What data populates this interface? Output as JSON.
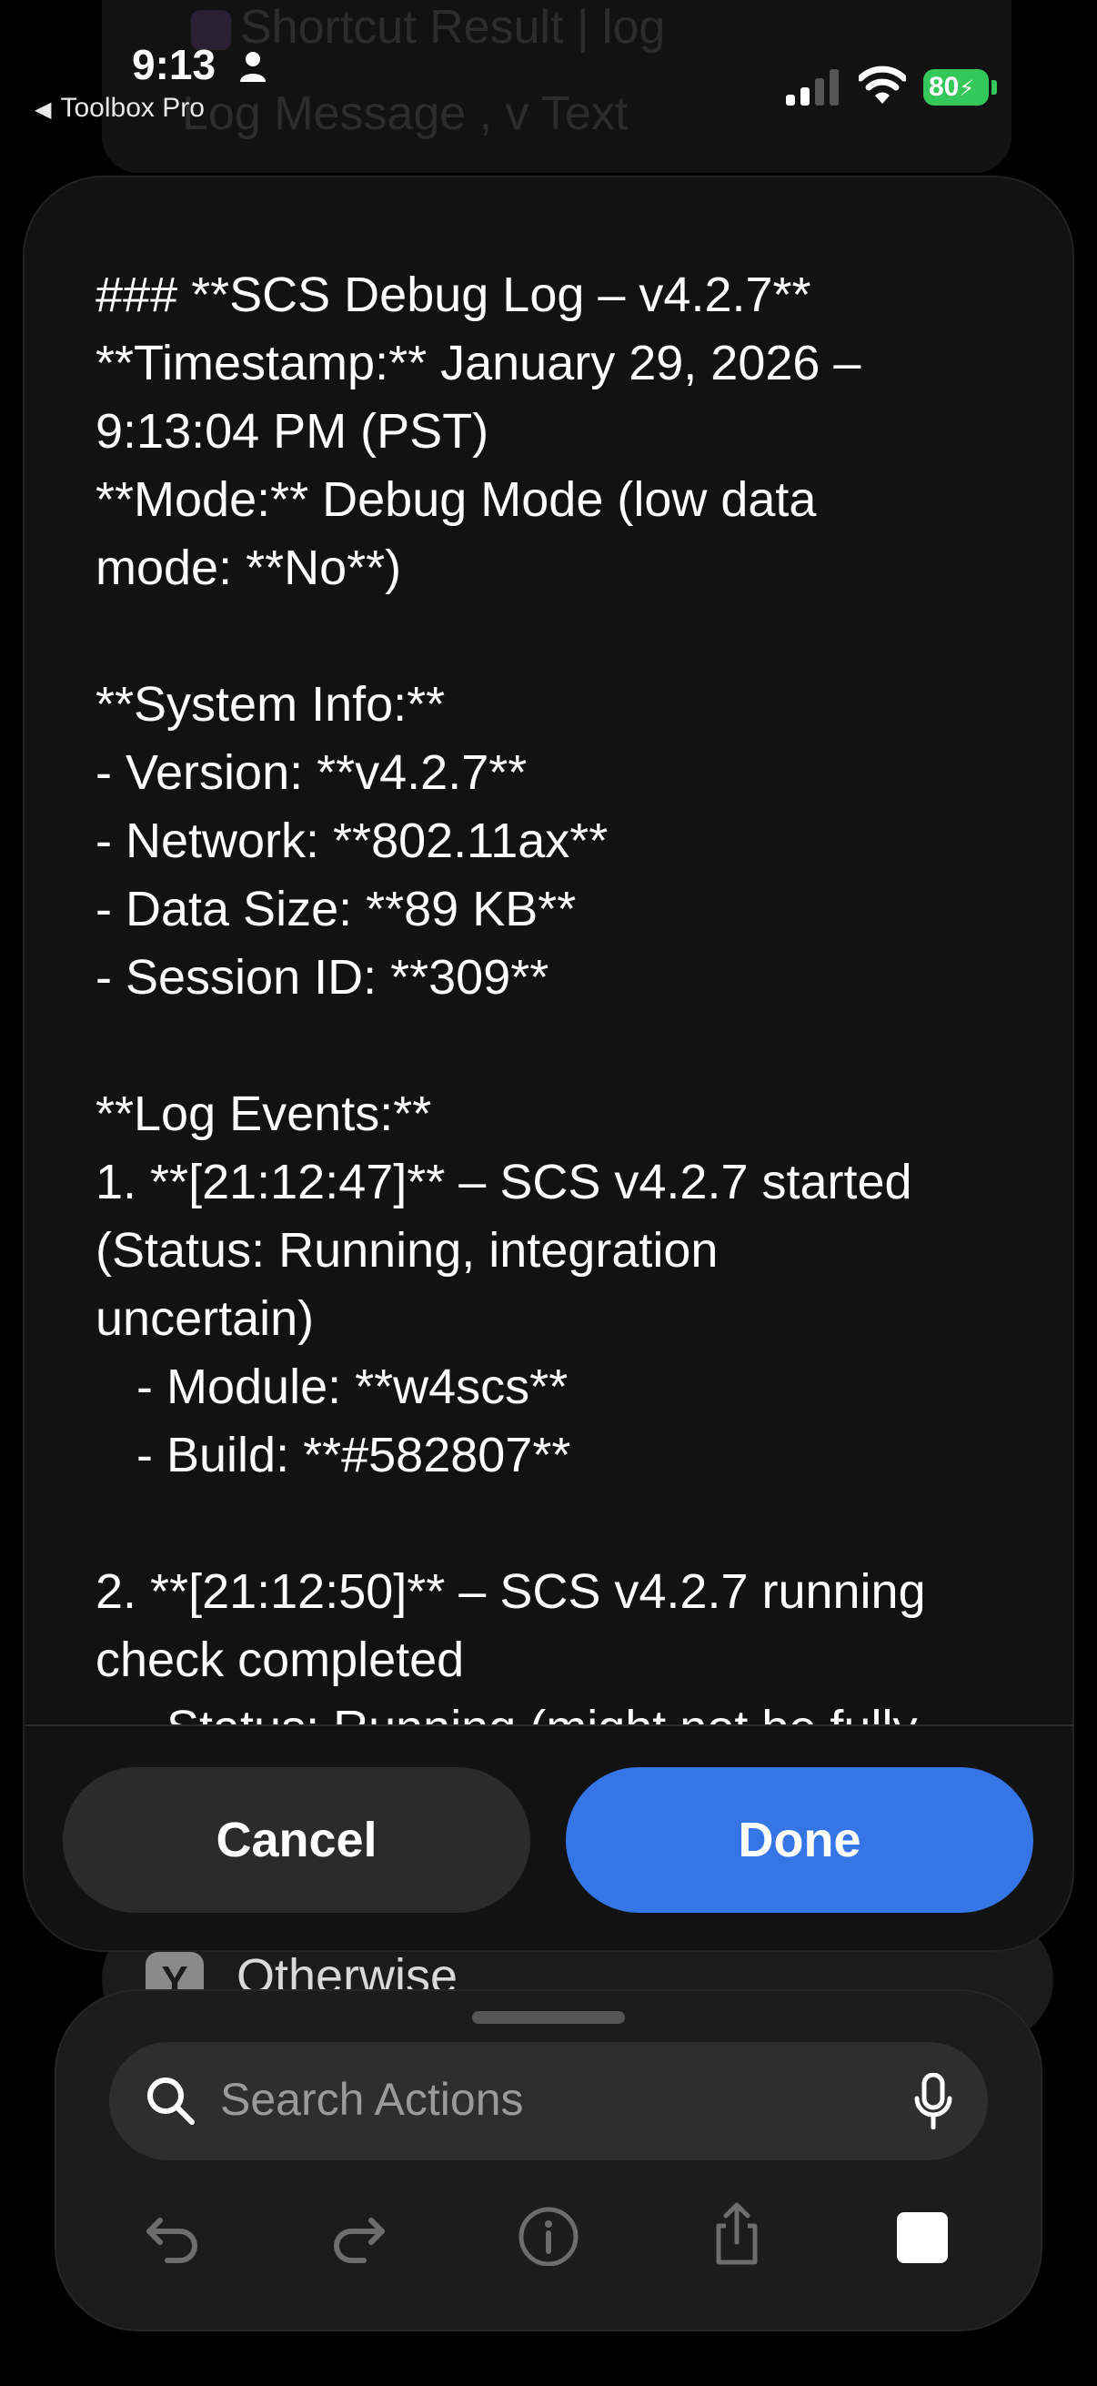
{
  "status_bar": {
    "time": "9:13",
    "back_app": "Toolbox Pro",
    "battery": "80"
  },
  "background": {
    "ghost_line_1": "Shortcut Result | log",
    "ghost_line_2": "Log Message , v  Text",
    "otherwise_label": "Otherwise"
  },
  "log": {
    "lines": [
      "--",
      "",
      "### **SCS Debug Log – v4.2.7**",
      "**Timestamp:** January 29, 2026 –",
      "9:13:04 PM (PST)",
      "**Mode:** Debug Mode (low data",
      "mode: **No**)",
      "",
      "**System Info:**",
      "- Version: **v4.2.7**",
      "- Network: **802.11ax**",
      "- Data Size: **89 KB**",
      "- Session ID: **309**",
      "",
      "**Log Events:**",
      "1. **[21:12:47]** – SCS v4.2.7 started",
      "(Status: Running, integration",
      "uncertain)",
      "   - Module: **w4scs**",
      "   - Build: **#582807**",
      "",
      "2. **[21:12:50]** – SCS v4.2.7 running",
      "check completed",
      "   - Status: Running (might not be fully"
    ]
  },
  "buttons": {
    "cancel": "Cancel",
    "done": "Done"
  },
  "search": {
    "placeholder": "Search Actions"
  },
  "toolbar": {
    "icons": [
      "undo-icon",
      "redo-icon",
      "info-icon",
      "share-icon",
      "stop-icon"
    ]
  },
  "colors": {
    "accent": "#3575e6",
    "battery": "#34c759"
  }
}
